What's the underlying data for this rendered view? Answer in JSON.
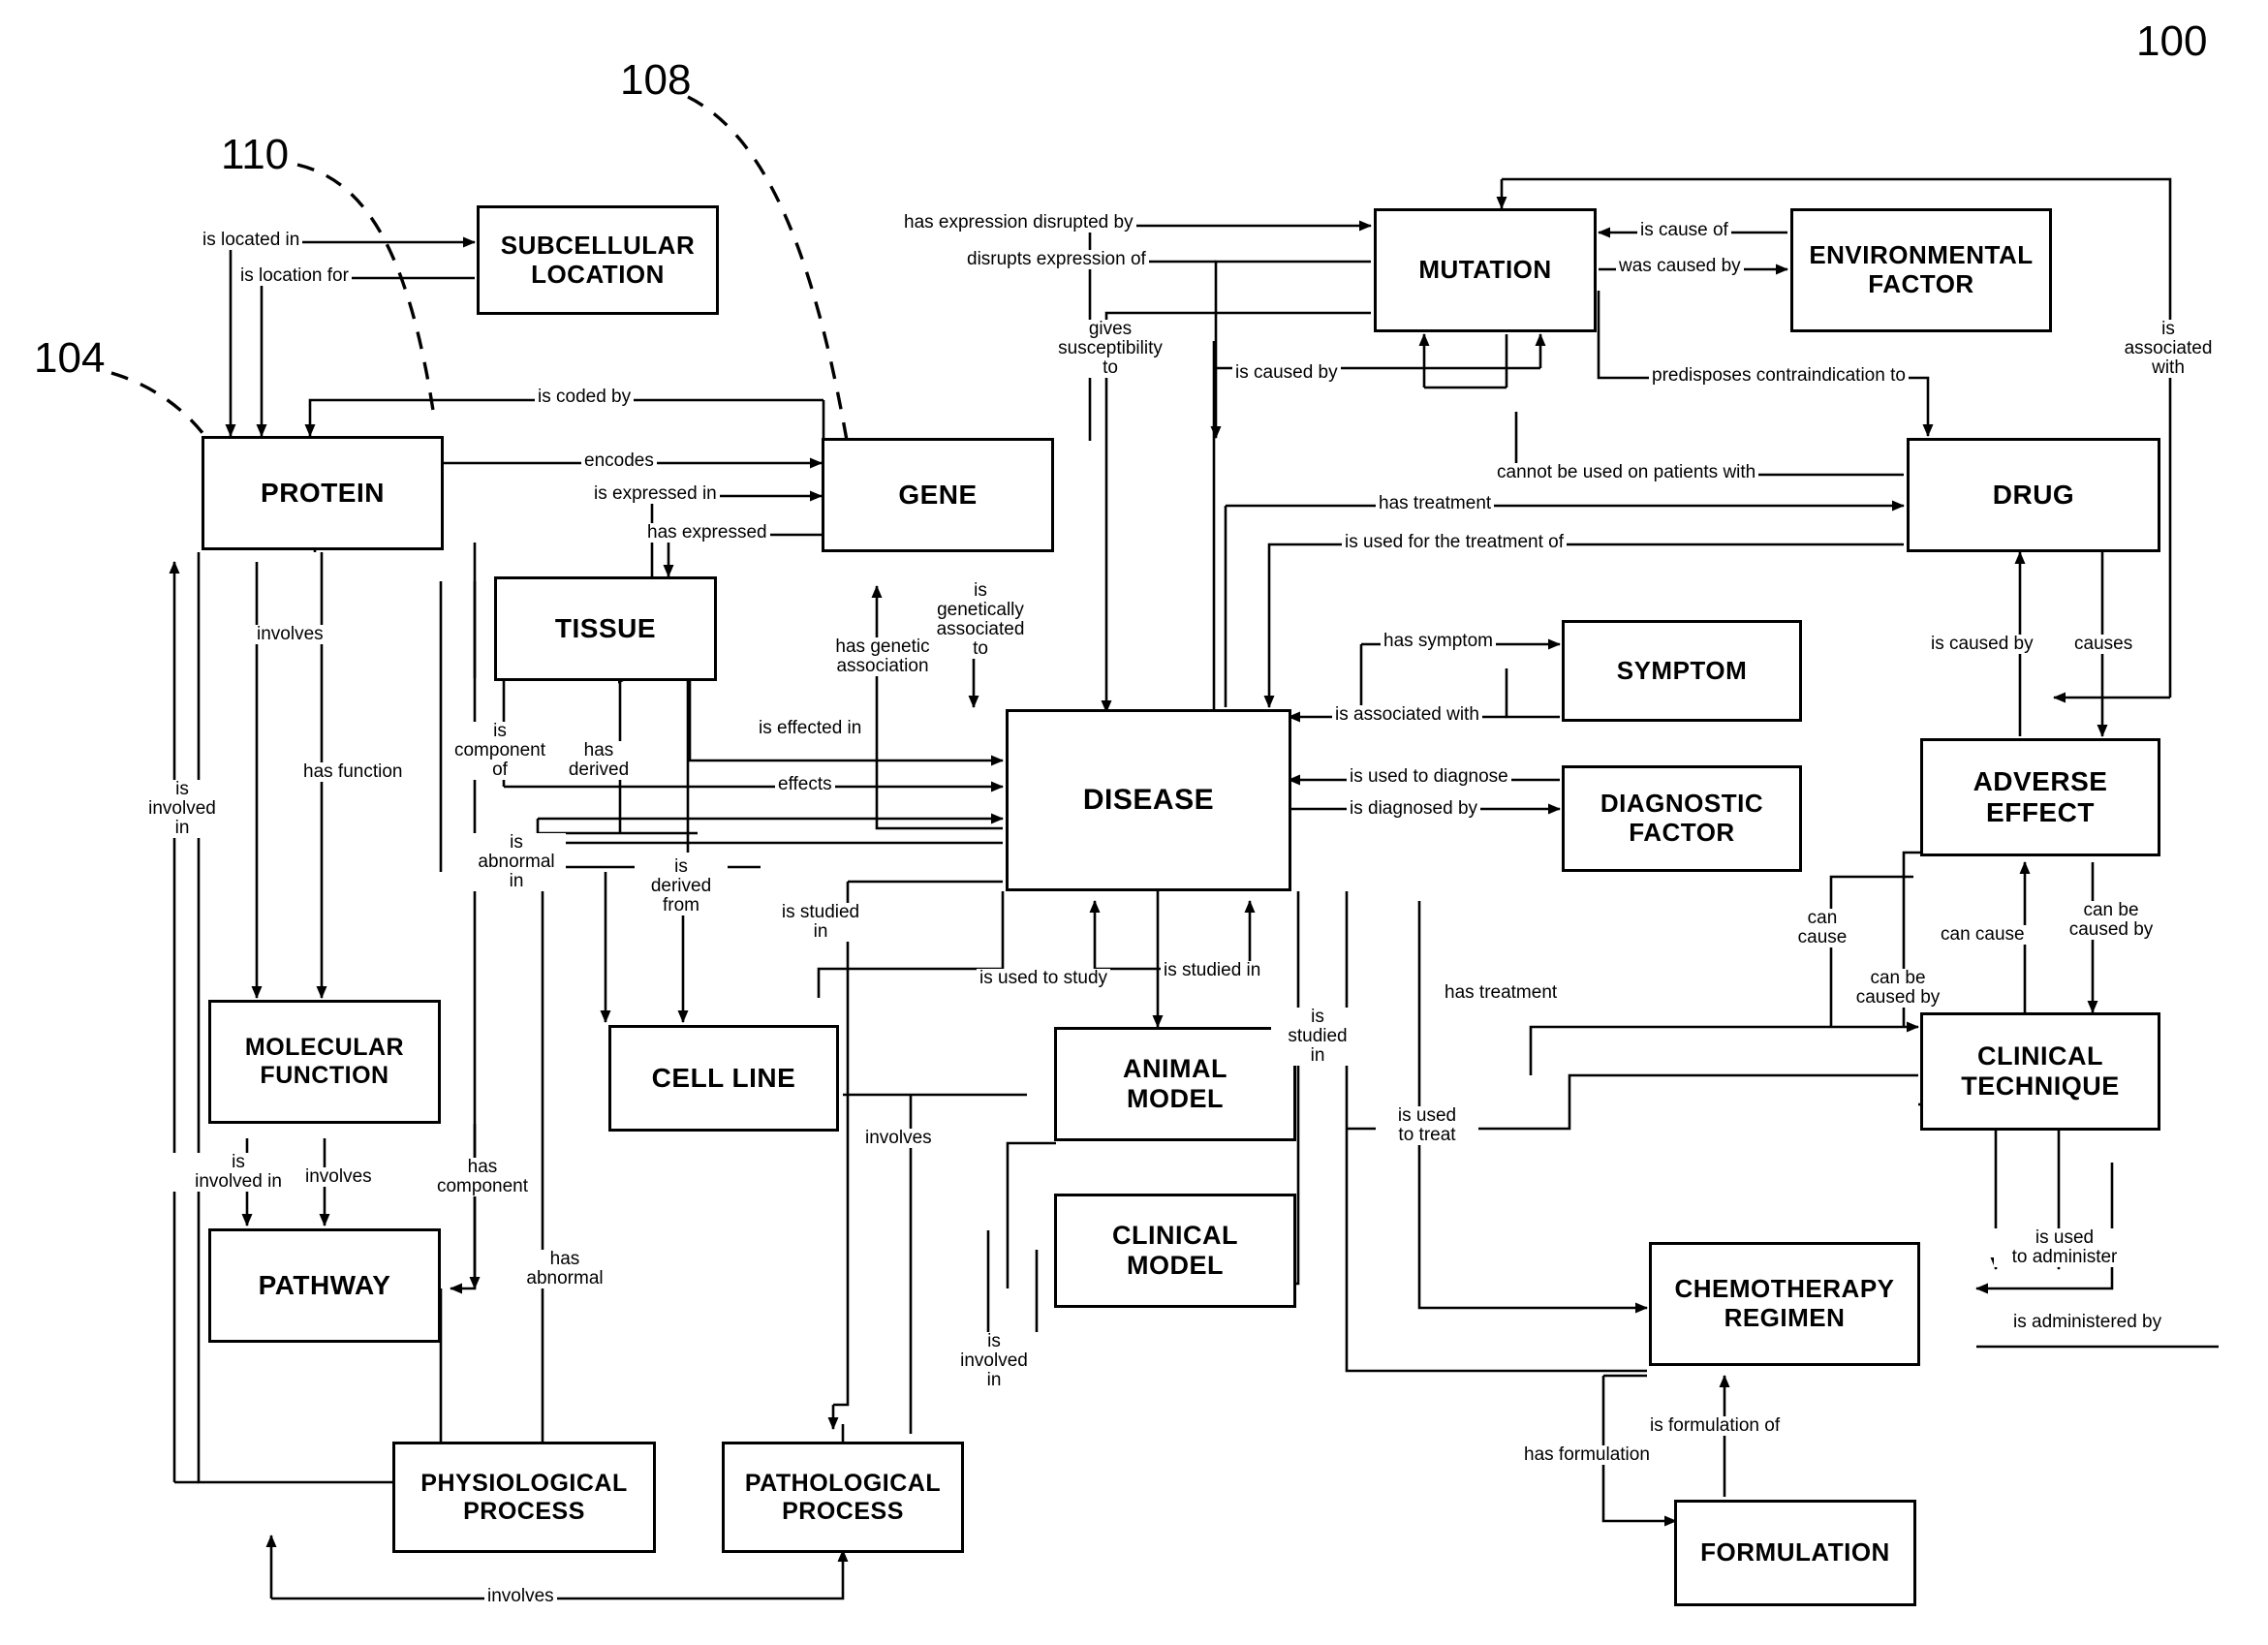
{
  "figure": {
    "ref_numbers": [
      {
        "id": "ref-100",
        "text": "100"
      },
      {
        "id": "ref-104",
        "text": "104"
      },
      {
        "id": "ref-108",
        "text": "108"
      },
      {
        "id": "ref-110",
        "text": "110"
      }
    ]
  },
  "nodes": [
    {
      "id": "subcellular-location",
      "label": "SUBCELLULAR\nLOCATION"
    },
    {
      "id": "mutation",
      "label": "MUTATION"
    },
    {
      "id": "environmental-factor",
      "label": "ENVIRONMENTAL\nFACTOR"
    },
    {
      "id": "protein",
      "label": "PROTEIN"
    },
    {
      "id": "gene",
      "label": "GENE"
    },
    {
      "id": "drug",
      "label": "DRUG"
    },
    {
      "id": "tissue",
      "label": "TISSUE"
    },
    {
      "id": "symptom",
      "label": "SYMPTOM"
    },
    {
      "id": "disease",
      "label": "DISEASE"
    },
    {
      "id": "diagnostic-factor",
      "label": "DIAGNOSTIC\nFACTOR"
    },
    {
      "id": "adverse-effect",
      "label": "ADVERSE\nEFFECT"
    },
    {
      "id": "molecular-function",
      "label": "MOLECULAR\nFUNCTION"
    },
    {
      "id": "cell-line",
      "label": "CELL LINE"
    },
    {
      "id": "animal-model",
      "label": "ANIMAL\nMODEL"
    },
    {
      "id": "clinical-technique",
      "label": "CLINICAL\nTECHNIQUE"
    },
    {
      "id": "pathway",
      "label": "PATHWAY"
    },
    {
      "id": "clinical-model",
      "label": "CLINICAL\nMODEL"
    },
    {
      "id": "chemotherapy-regimen",
      "label": "CHEMOTHERAPY\nREGIMEN"
    },
    {
      "id": "physiological-process",
      "label": "PHYSIOLOGICAL\nPROCESS"
    },
    {
      "id": "pathological-process",
      "label": "PATHOLOGICAL\nPROCESS"
    },
    {
      "id": "formulation",
      "label": "FORMULATION"
    }
  ],
  "edge_labels": [
    {
      "id": "is-located-in",
      "text": "is located in"
    },
    {
      "id": "is-location-for",
      "text": "is location for"
    },
    {
      "id": "is-coded-by",
      "text": "is coded by"
    },
    {
      "id": "encodes",
      "text": "encodes"
    },
    {
      "id": "is-expressed-in",
      "text": "is expressed in"
    },
    {
      "id": "has-expressed",
      "text": "has expressed"
    },
    {
      "id": "has-expression-disrupted-by",
      "text": "has expression disrupted by"
    },
    {
      "id": "disrupts-expression-of",
      "text": "disrupts expression of"
    },
    {
      "id": "gives-susceptibility-to",
      "text": "gives\nsusceptibility\nto"
    },
    {
      "id": "is-caused-by-mutation",
      "text": "is caused by"
    },
    {
      "id": "is-cause-of",
      "text": "is cause of"
    },
    {
      "id": "was-caused-by",
      "text": "was caused by"
    },
    {
      "id": "predisposes-contraindication-to",
      "text": "predisposes contraindication to"
    },
    {
      "id": "is-associated-with-right",
      "text": "is\nassociated\nwith"
    },
    {
      "id": "cannot-be-used-on-patients-with",
      "text": "cannot be used on patients with"
    },
    {
      "id": "has-treatment-drug",
      "text": "has treatment"
    },
    {
      "id": "is-used-for-the-treatment-of",
      "text": "is used for the treatment of"
    },
    {
      "id": "involves-protein",
      "text": "involves"
    },
    {
      "id": "has-function",
      "text": "has function"
    },
    {
      "id": "is-component-of",
      "text": "is\ncomponent\nof"
    },
    {
      "id": "is-involved-in-left",
      "text": "is\ninvolved\nin"
    },
    {
      "id": "has-derived",
      "text": "has\nderived"
    },
    {
      "id": "is-genetically-associated-to",
      "text": "is\ngenetically\nassociated\nto"
    },
    {
      "id": "has-genetic-association",
      "text": "has genetic\nassociation"
    },
    {
      "id": "is-effected-in",
      "text": "is effected in"
    },
    {
      "id": "effects",
      "text": "effects"
    },
    {
      "id": "has-symptom",
      "text": "has symptom"
    },
    {
      "id": "is-associated-with-symptom",
      "text": "is associated with"
    },
    {
      "id": "is-used-to-diagnose",
      "text": "is used to diagnose"
    },
    {
      "id": "is-diagnosed-by",
      "text": "is diagnosed by"
    },
    {
      "id": "is-caused-by-drug",
      "text": "is caused by"
    },
    {
      "id": "causes",
      "text": "causes"
    },
    {
      "id": "is-abnormal-in",
      "text": "is\nabnormal\nin"
    },
    {
      "id": "is-derived-from",
      "text": "is\nderived\nfrom"
    },
    {
      "id": "is-studied-in-cellline",
      "text": "is studied\nin"
    },
    {
      "id": "is-used-to-study",
      "text": "is used to study"
    },
    {
      "id": "is-studied-in-animal",
      "text": "is studied in"
    },
    {
      "id": "is-studied-in-clinical",
      "text": "is\nstudied\nin"
    },
    {
      "id": "can-cause-ct",
      "text": "can\ncause"
    },
    {
      "id": "can-cause-ae",
      "text": "can cause"
    },
    {
      "id": "can-be-caused-by-ct",
      "text": "can be\ncaused by"
    },
    {
      "id": "can-be-caused-by-ae",
      "text": "can be\ncaused by"
    },
    {
      "id": "has-treatment-chemo",
      "text": "has treatment"
    },
    {
      "id": "is-used-to-treat",
      "text": "is used\nto treat"
    },
    {
      "id": "involves-cellline",
      "text": "involves"
    },
    {
      "id": "is-involved-in-patho",
      "text": "is\ninvolved\nin"
    },
    {
      "id": "is-involved-in-mf",
      "text": "is\ninvolved in"
    },
    {
      "id": "involves-pathway",
      "text": "involves"
    },
    {
      "id": "has-component",
      "text": "has\ncomponent"
    },
    {
      "id": "has-abnormal",
      "text": "has\nabnormal"
    },
    {
      "id": "is-used-to-administer",
      "text": "is used\nto administer"
    },
    {
      "id": "is-administered-by",
      "text": "is administered by"
    },
    {
      "id": "is-formulation-of",
      "text": "is formulation of"
    },
    {
      "id": "has-formulation",
      "text": "has formulation"
    },
    {
      "id": "involves-bottom",
      "text": "involves"
    }
  ]
}
